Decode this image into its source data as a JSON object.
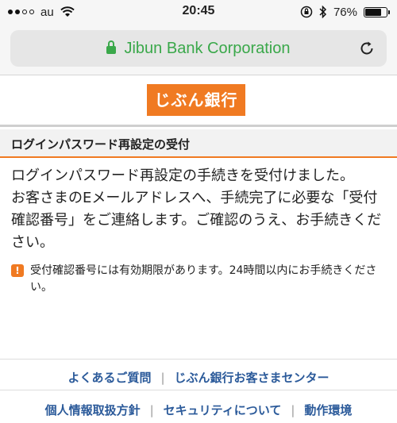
{
  "status_bar": {
    "carrier": "au",
    "time": "20:45",
    "battery_percent": "76%",
    "battery_level": 0.76,
    "icons": [
      "signal-dots-icon",
      "wifi-icon",
      "orientation-lock-icon",
      "bluetooth-icon",
      "battery-icon"
    ]
  },
  "browser": {
    "url_title": "Jibun Bank Corporation",
    "icons": [
      "lock-icon",
      "reload-icon"
    ],
    "url_color": "#3aa84a"
  },
  "logo": {
    "text": "じぶん銀行",
    "brand_color": "#f07a22"
  },
  "section": {
    "title": "ログインパスワード再設定の受付"
  },
  "body": {
    "paragraph1": "ログインパスワード再設定の手続きを受付けました。",
    "paragraph2": "お客さまのEメールアドレスへ、手続完了に必要な「受付確認番号」をご連絡します。ご確認のうえ、お手続きください。"
  },
  "notice": {
    "icon": "exclamation-icon",
    "text": "受付確認番号には有効期限があります。24時間以内にお手続きください。"
  },
  "footer": {
    "row1": [
      "よくあるご質問",
      "じぶん銀行お客さまセンター"
    ],
    "row2": [
      "個人情報取扱方針",
      "セキュリティについて",
      "動作環境"
    ],
    "link_color": "#2b5a9a"
  }
}
